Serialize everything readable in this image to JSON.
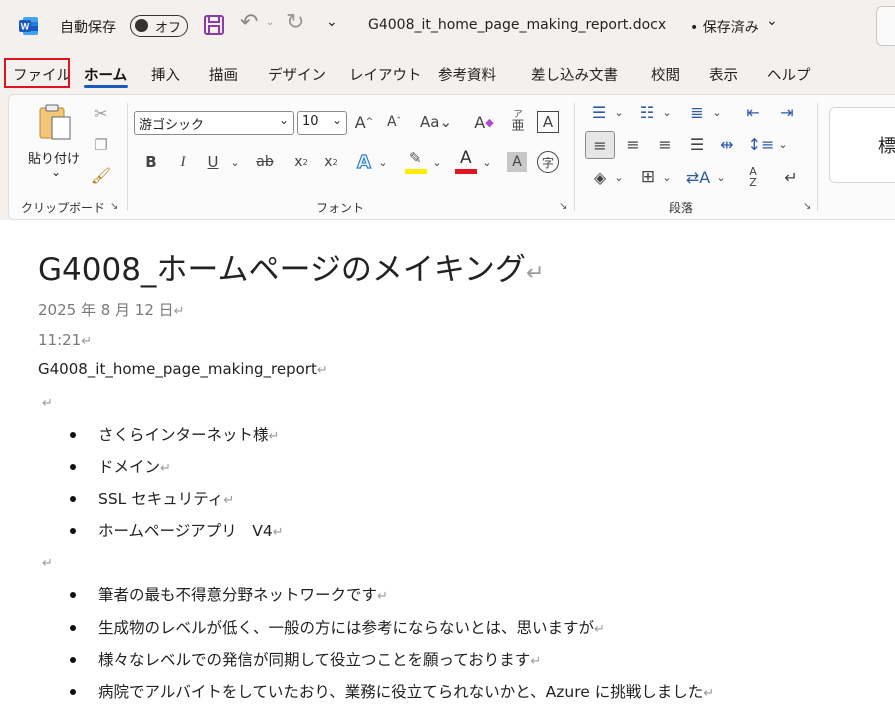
{
  "titlebar": {
    "autosave_label": "自動保存",
    "autosave_state": "オフ",
    "filename": "G4008_it_home_page_making_report.docx",
    "save_status": "• 保存済み"
  },
  "tabs": [
    "ファイル",
    "ホーム",
    "挿入",
    "描画",
    "デザイン",
    "レイアウト",
    "参考資料",
    "差し込み文書",
    "校閲",
    "表示",
    "ヘルプ"
  ],
  "ribbon": {
    "paste_label": "貼り付け",
    "clipboard_label": "クリップボード",
    "font_label": "フォント",
    "paragraph_label": "段落",
    "font_name": "游ゴシック",
    "font_size": "10",
    "styles_partial": "標"
  },
  "document": {
    "title": "G4008_ホームページのメイキング",
    "date": "2025 年 8 月 12 日",
    "time": "11:21",
    "filename_line": "G4008_it_home_page_making_report",
    "list1": [
      "さくらインターネット様",
      "ドメイン",
      "SSL セキュリティ",
      "ホームページアプリ　V4"
    ],
    "list2": [
      "筆者の最も不得意分野ネットワークです",
      "生成物のレベルが低く、一般の方には参考にならないとは、思いますが",
      "様々なレベルでの発信が同期して役立つことを願っております",
      "病院でアルバイトをしていたおり、業務に役立てられないかと、Azure に挑戦しました"
    ]
  }
}
